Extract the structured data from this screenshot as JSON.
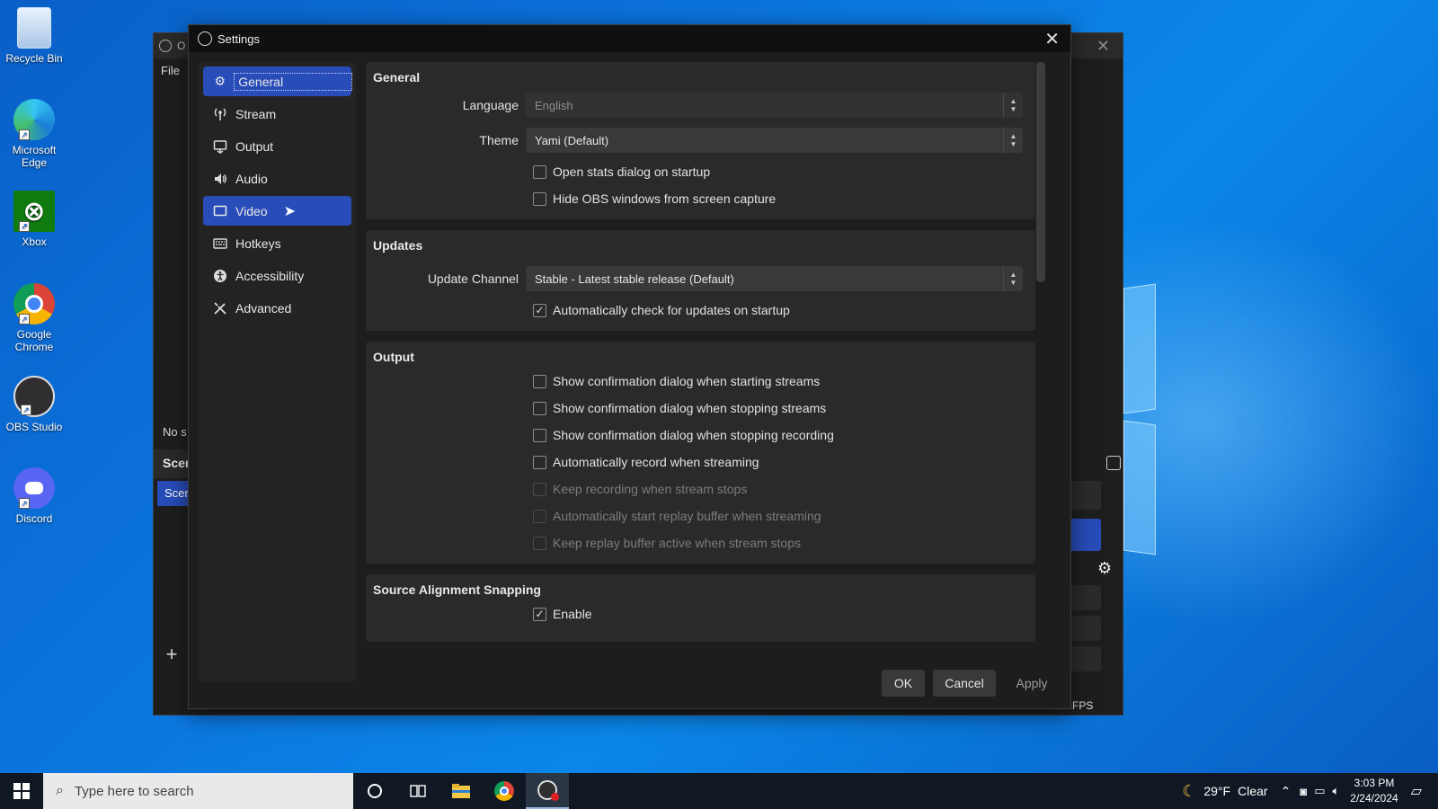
{
  "desktop": {
    "icons": [
      {
        "label": "Recycle Bin"
      },
      {
        "label": "Microsoft Edge"
      },
      {
        "label": "Xbox"
      },
      {
        "label": "Google Chrome"
      },
      {
        "label": "OBS Studio"
      },
      {
        "label": "Discord"
      }
    ]
  },
  "obs_main": {
    "title_fragment": "O",
    "menu_file": "File",
    "no_source_fragment": "No s",
    "scenes_header_fragment": "Scen",
    "scene_item_fragment": "Scen",
    "fps_label": "FPS"
  },
  "dialog": {
    "title": "Settings",
    "sidebar": [
      {
        "label": "General",
        "icon": "gear-icon"
      },
      {
        "label": "Stream",
        "icon": "antenna-icon"
      },
      {
        "label": "Output",
        "icon": "output-icon"
      },
      {
        "label": "Audio",
        "icon": "speaker-icon"
      },
      {
        "label": "Video",
        "icon": "monitor-icon"
      },
      {
        "label": "Hotkeys",
        "icon": "keyboard-icon"
      },
      {
        "label": "Accessibility",
        "icon": "accessibility-icon"
      },
      {
        "label": "Advanced",
        "icon": "tools-icon"
      }
    ],
    "general": {
      "title": "General",
      "language_label": "Language",
      "language_value": "English",
      "theme_label": "Theme",
      "theme_value": "Yami (Default)",
      "checks": [
        {
          "label": "Open stats dialog on startup",
          "checked": false
        },
        {
          "label": "Hide OBS windows from screen capture",
          "checked": false
        }
      ]
    },
    "updates": {
      "title": "Updates",
      "channel_label": "Update Channel",
      "channel_value": "Stable - Latest stable release (Default)",
      "checks": [
        {
          "label": "Automatically check for updates on startup",
          "checked": true
        }
      ]
    },
    "output": {
      "title": "Output",
      "checks": [
        {
          "label": "Show confirmation dialog when starting streams",
          "checked": false,
          "disabled": false
        },
        {
          "label": "Show confirmation dialog when stopping streams",
          "checked": false,
          "disabled": false
        },
        {
          "label": "Show confirmation dialog when stopping recording",
          "checked": false,
          "disabled": false
        },
        {
          "label": "Automatically record when streaming",
          "checked": false,
          "disabled": false
        },
        {
          "label": "Keep recording when stream stops",
          "checked": false,
          "disabled": true
        },
        {
          "label": "Automatically start replay buffer when streaming",
          "checked": false,
          "disabled": true
        },
        {
          "label": "Keep replay buffer active when stream stops",
          "checked": false,
          "disabled": true
        }
      ]
    },
    "snapping": {
      "title": "Source Alignment Snapping",
      "checks": [
        {
          "label": "Enable",
          "checked": true
        }
      ]
    },
    "buttons": {
      "ok": "OK",
      "cancel": "Cancel",
      "apply": "Apply"
    }
  },
  "taskbar": {
    "search_placeholder": "Type here to search",
    "weather_temp": "29°F",
    "weather_desc": "Clear",
    "time": "3:03 PM",
    "date": "2/24/2024"
  },
  "colors": {
    "accent": "#284cb8",
    "dialog_bg": "#1e1d1e",
    "panel_bg": "#2b2a2b"
  }
}
